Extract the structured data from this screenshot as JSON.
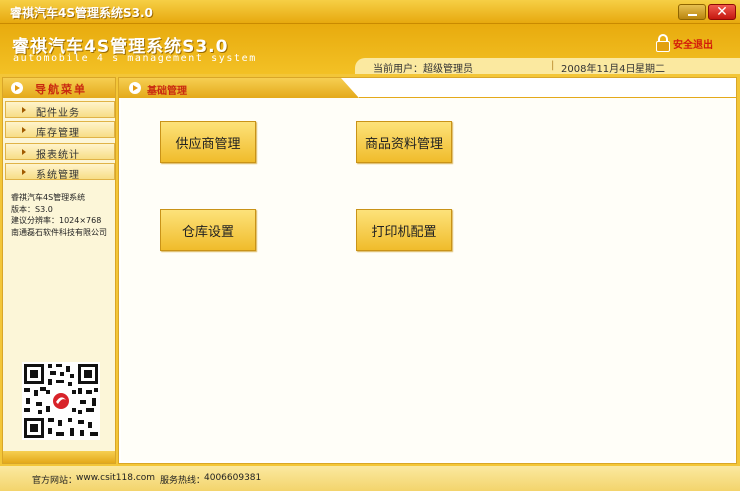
{
  "window": {
    "title": "睿祺汽车4S管理系统S3.0",
    "minimize_icon": "minimize-icon",
    "close_icon": "close-icon",
    "close_glyph": "✕"
  },
  "header": {
    "app_title": "睿祺汽车4S管理系统S3.0",
    "app_subtitle": "automobile 4 s management system",
    "logout_label": "安全退出",
    "logout_icon": "lock-icon"
  },
  "infobar": {
    "user_label": "当前用户：超级管理员",
    "date": "2008年11月4日",
    "weekday": "星期二",
    "separator": "|"
  },
  "sidebar": {
    "title": "导航菜单",
    "items": [
      {
        "label": "配件业务"
      },
      {
        "label": "库存管理"
      },
      {
        "label": "报表统计"
      },
      {
        "label": "系统管理"
      }
    ],
    "info": [
      "睿祺汽车4S管理系统",
      "版本：S3.0",
      "建议分辨率：1024×768",
      "南通磊石软件科技有限公司"
    ]
  },
  "content": {
    "tab_label": "基础管理",
    "tiles": [
      {
        "label": "供应商管理"
      },
      {
        "label": "商品资料管理"
      },
      {
        "label": "仓库设置"
      },
      {
        "label": "打印机配置"
      }
    ]
  },
  "footer": {
    "website_label": "官方网站：",
    "website": "www.csit118.com",
    "hotline_label": "服务热线：",
    "hotline": "4006609381"
  },
  "colors": {
    "accent": "#f3c638",
    "title_red": "#c92a10",
    "close_red": "#d21a0a"
  }
}
